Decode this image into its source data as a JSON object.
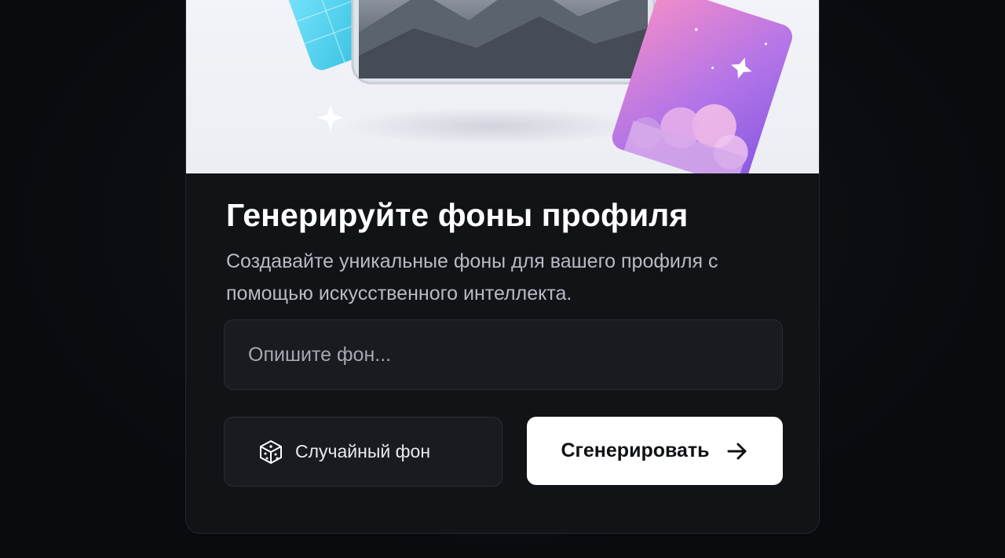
{
  "panel": {
    "title": "Генерируйте фоны профиля",
    "subtitle": "Создавайте уникальные фоны для вашего профиля с помощью искусственного интеллекта."
  },
  "prompt_input": {
    "placeholder": "Опишите фон...",
    "value": ""
  },
  "actions": {
    "random_label": "Случайный фон",
    "random_icon": "dice-icon",
    "generate_label": "Сгенерировать",
    "generate_icon": "arrow-right-icon"
  },
  "colors": {
    "background": "#0b0c10",
    "card": "#111317",
    "primary_button": "#ffffff",
    "secondary_button": "#191b20"
  }
}
